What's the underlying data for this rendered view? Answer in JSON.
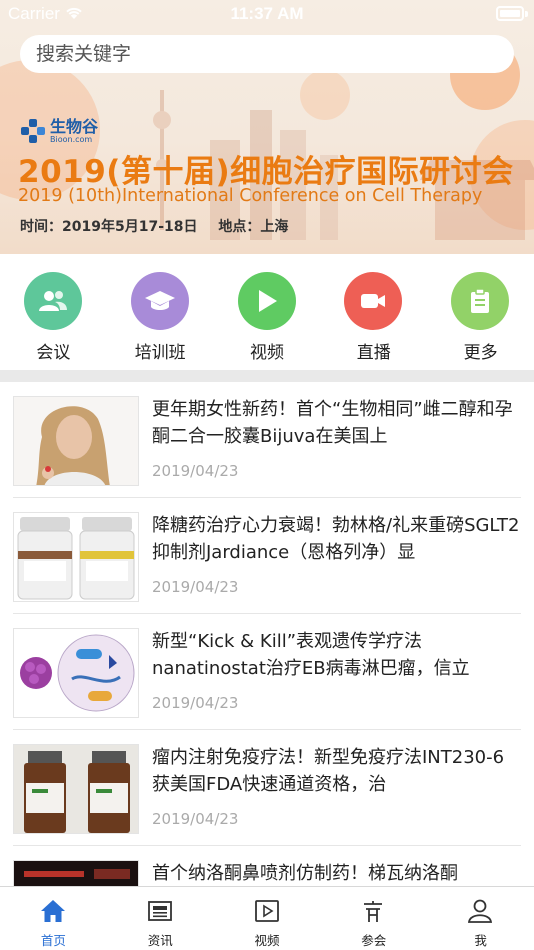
{
  "status_bar": {
    "carrier": "Carrier",
    "time": "11:37 AM"
  },
  "search": {
    "placeholder": "搜索关键字"
  },
  "banner": {
    "logo_cn": "生物谷",
    "logo_en": "Bioon.com",
    "title_cn": "2019(第十届)细胞治疗国际研讨会",
    "title_en": "2019 (10th)International Conference on Cell Therapy",
    "date_text": "时间：2019年5月17-18日",
    "place_text": "地点：上海"
  },
  "quick_nav": [
    {
      "label": "会议",
      "icon": "people-icon",
      "color": "#5ec79a"
    },
    {
      "label": "培训班",
      "icon": "graduation-cap-icon",
      "color": "#a88bd8"
    },
    {
      "label": "视频",
      "icon": "play-icon",
      "color": "#5fcb62"
    },
    {
      "label": "直播",
      "icon": "video-camera-icon",
      "color": "#ee5f55"
    },
    {
      "label": "更多",
      "icon": "clipboard-icon",
      "color": "#92d268"
    }
  ],
  "news": [
    {
      "title": "更年期女性新药！首个“生物相同”雌二醇和孕酮二合一胶囊Bijuva在美国上",
      "date": "2019/04/23",
      "thumb": "woman-photo"
    },
    {
      "title": "降糖药治疗心力衰竭！勃林格/礼来重磅SGLT2抑制剂Jardiance（恩格列净）显",
      "date": "2019/04/23",
      "thumb": "medicine-bottles"
    },
    {
      "title": "新型“Kick & Kill”表观遗传学疗法nanatinostat治疗EB病毒淋巴瘤，信立",
      "date": "2019/04/23",
      "thumb": "cell-diagram"
    },
    {
      "title": "瘤内注射免疫疗法！新型免疫疗法INT230-6获美国FDA快速通道资格，治",
      "date": "2019/04/23",
      "thumb": "vials"
    },
    {
      "title": "首个纳洛酮鼻喷剂仿制药！梯瓦纳洛酮",
      "date": "",
      "thumb": "dark-image"
    }
  ],
  "tab_bar": [
    {
      "label": "首页",
      "icon": "home-icon",
      "active": true
    },
    {
      "label": "资讯",
      "icon": "newspaper-icon",
      "active": false
    },
    {
      "label": "视频",
      "icon": "video-icon",
      "active": false
    },
    {
      "label": "参会",
      "icon": "meeting-icon",
      "active": false
    },
    {
      "label": "我",
      "icon": "user-icon",
      "active": false
    }
  ],
  "colors": {
    "accent": "#2a6fd3",
    "banner_orange": "#ea7b12",
    "date_gray": "#aaaaaa"
  }
}
